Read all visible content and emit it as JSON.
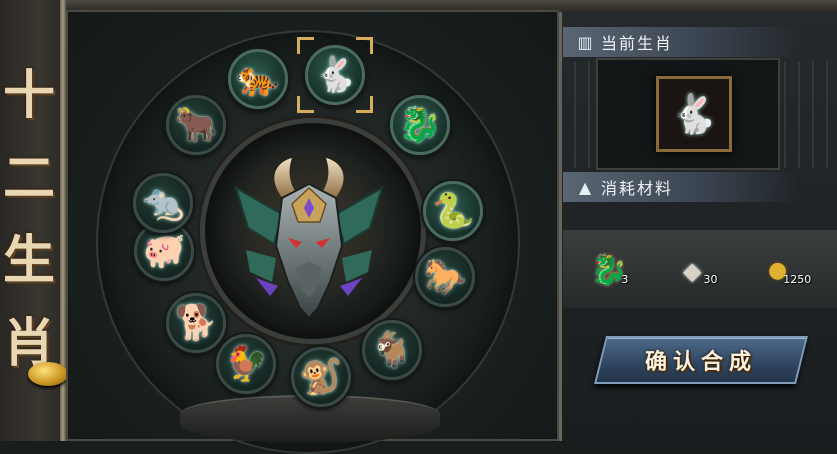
{
  "side_title": [
    "十",
    "二",
    "生",
    "肖"
  ],
  "zodiac_wheel": [
    {
      "icon": "tiger-icon",
      "glyph": "🐅",
      "selected": false
    },
    {
      "icon": "rabbit-icon",
      "glyph": "🐇",
      "selected": true
    },
    {
      "icon": "dragon-icon",
      "glyph": "🐉",
      "selected": false
    },
    {
      "icon": "snake-icon",
      "glyph": "🐍",
      "selected": false
    },
    {
      "icon": "horse-icon",
      "glyph": "🐎",
      "selected": false
    },
    {
      "icon": "goat-icon",
      "glyph": "🐐",
      "selected": false
    },
    {
      "icon": "monkey-icon",
      "glyph": "🐒",
      "selected": false
    },
    {
      "icon": "rooster-icon",
      "glyph": "🐓",
      "selected": false
    },
    {
      "icon": "dog-icon",
      "glyph": "🐕",
      "selected": false
    },
    {
      "icon": "pig-icon",
      "glyph": "🐖",
      "selected": false
    },
    {
      "icon": "rat-icon",
      "glyph": "🐀",
      "selected": false
    },
    {
      "icon": "ox-icon",
      "glyph": "🐂",
      "selected": false
    }
  ],
  "current_zodiac": {
    "header": "当前生肖",
    "icon": "rabbit-icon",
    "glyph": "🐇"
  },
  "materials": {
    "header": "消耗材料",
    "items": [
      {
        "icon": "zodiac-fragment-icon",
        "glyph": "🐉",
        "count": "3"
      },
      {
        "icon": "crystal-shard-icon",
        "glyph": "◆",
        "count": "30"
      },
      {
        "icon": "gold-coin-icon",
        "glyph": "●",
        "count": "1250"
      }
    ]
  },
  "confirm_button": "确认合成",
  "colors": {
    "accent_gold": "#d6ad5d",
    "header_blue": "#5a6674",
    "button_blue": "#2f4560",
    "jade": "#9fd7c6"
  }
}
